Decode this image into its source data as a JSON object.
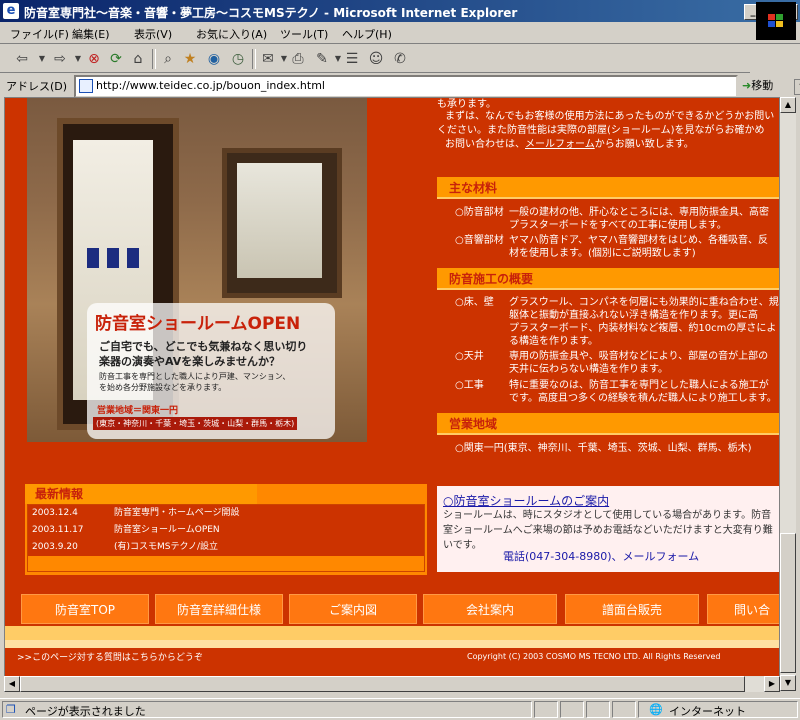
{
  "window": {
    "title": "防音室専門社～音楽・音響・夢工房～コスモMSテクノ - Microsoft Internet Explorer",
    "minimize": "_",
    "maximize": "□",
    "close": "×"
  },
  "menu": [
    "ファイル(F)",
    "編集(E)",
    "表示(V)",
    "お気に入り(A)",
    "ツール(T)",
    "ヘルプ(H)"
  ],
  "address": {
    "label": "アドレス(D)",
    "url": "http://www.teidec.co.jp/bouon_index.html",
    "go": "移動"
  },
  "status": {
    "text": "ページが表示されました",
    "zone": "インターネット"
  },
  "promo": {
    "title": "防音室ショールームOPEN",
    "line1": "ご自宅でも、どこでも気兼ねなく思い切り",
    "line2": "楽器の演奏やAVを楽しみませんか？",
    "small1": "防音工事を専門とした職人により戸建、マンション、",
    "small2": "を始め各分野施設などを承ります。",
    "area_label": "営業地域＝関東一円",
    "area_list": "(東京・神奈川・千葉・埼玉・茨城・山梨・群馬・栃木)"
  },
  "intro": {
    "line0": "も承ります。",
    "line1": "まずは、なんでもお客様の使用方法にあったものができるかどうかお問い",
    "line2": "ください。また防音性能は実際の部屋(ショールーム)を見ながらお確かめ",
    "line3_pre": "お問い合わせは、",
    "line3_link": "メールフォーム",
    "line3_post": "からお願い致します。"
  },
  "materials": {
    "heading": "主な材料",
    "rows": [
      {
        "label": "○防音部材",
        "lines": [
          "一般の建材の他、肝心なところには、専用防振金具、高密",
          "プラスターボードをすべての工事に使用します。"
        ]
      },
      {
        "label": "○音響部材",
        "lines": [
          "ヤマハ防音ドア、ヤマハ音響部材をはじめ、各種吸音、反",
          "材を使用します。(個別にご説明致します)"
        ]
      }
    ]
  },
  "construction": {
    "heading": "防音施工の概要",
    "rows": [
      {
        "label": "○床、壁",
        "lines": [
          "グラスウール、コンパネを何層にも効果的に重ね合わせ、規",
          "躯体と振動が直接ふれない浮き構造を作ります。更に高",
          "プラスターボード、内装材料など複層、約10cmの厚さによ",
          "る構造を作ります。"
        ]
      },
      {
        "label": "○天井",
        "lines": [
          "専用の防振金具や、吸音材などにより、部屋の音が上部の",
          "天井に伝わらない構造を作ります。"
        ]
      },
      {
        "label": "○工事",
        "lines": [
          "特に重要なのは、防音工事を専門とした職人による施工が",
          "です。高度且つ多くの経験を積んだ職人により施工します。"
        ]
      }
    ]
  },
  "area": {
    "heading": "営業地域",
    "text": "○関東一円(東京、神奈川、千葉、埼玉、茨城、山梨、群馬、栃木)"
  },
  "news": {
    "heading": "最新情報",
    "items": [
      {
        "date": "2003.12.4",
        "text": "防音室専門・ホームページ開設"
      },
      {
        "date": "2003.11.17",
        "text": "防音室ショールームOPEN"
      },
      {
        "date": "2003.9.20",
        "text": "(有)コスモMSテクノ/設立"
      }
    ]
  },
  "showroom": {
    "heading": "○防音室ショールームのご案内",
    "body": "ショールームは、時にスタジオとして使用している場合があります。防音室ショールームへご来場の節は予めお電話などいただけますと大変有り難いです。",
    "phone": "電話(047-304-8980)",
    "sep": "、",
    "mail": "メールフォーム"
  },
  "nav": [
    "防音室TOP",
    "防音室詳細仕様",
    "ご案内図",
    "会社案内",
    "譜面台販売",
    "問い合"
  ],
  "footer": {
    "left": ">>このページ対する質問はこちらからどうぞ",
    "right": "Copyright (C) 2003 COSMO MS TECNO LTD. All Rights Reserved"
  }
}
